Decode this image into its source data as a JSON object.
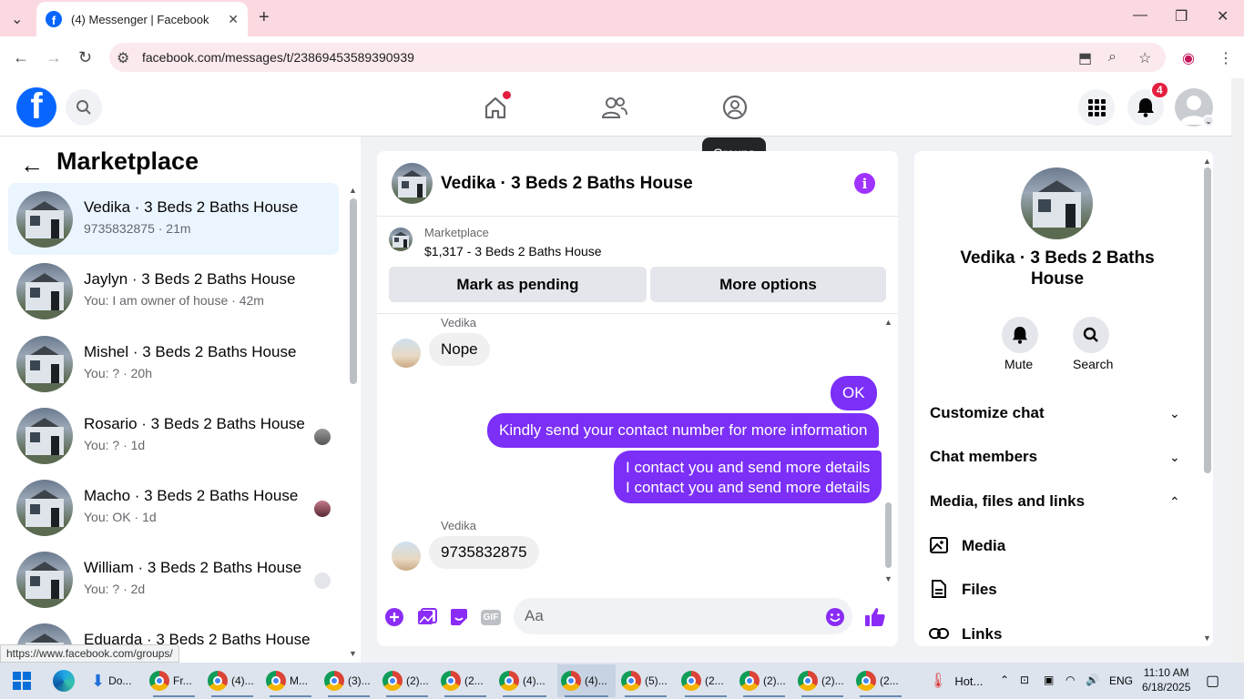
{
  "browser": {
    "tab_title": "(4) Messenger | Facebook",
    "url": "facebook.com/messages/t/23869453589390939",
    "status_url": "https://www.facebook.com/groups/"
  },
  "header": {
    "notifications_count": "4",
    "tooltip": "Groups"
  },
  "sidebar": {
    "title": "Marketplace",
    "conversations": [
      {
        "name": "Vedika · 3 Beds 2 Baths House",
        "preview": "9735832875 · 21m"
      },
      {
        "name": "Jaylyn · 3 Beds 2 Baths House",
        "preview": "You: I am owner of house · 42m"
      },
      {
        "name": "Mishel · 3 Beds 2 Baths House",
        "preview": "You: ? · 20h"
      },
      {
        "name": "Rosario · 3 Beds 2 Baths House",
        "preview": "You: ? · 1d"
      },
      {
        "name": "Macho · 3 Beds 2 Baths House",
        "preview": "You: OK · 1d"
      },
      {
        "name": "William · 3 Beds 2 Baths House",
        "preview": "You: ? · 2d"
      },
      {
        "name": "Eduarda · 3 Beds 2 Baths House",
        "preview": ""
      }
    ]
  },
  "chat": {
    "title": "Vedika · 3 Beds 2 Baths House",
    "marketplace_label": "Marketplace",
    "listing": "$1,317 - 3 Beds 2 Baths House",
    "mark_pending": "Mark as pending",
    "more_options": "More options",
    "messages": [
      {
        "sender": "Vedika",
        "text": "Nope"
      },
      {
        "text": "OK"
      },
      {
        "text": "Kindly send your contact number for more information"
      },
      {
        "text": "I contact you and send more details"
      },
      {
        "text": "I contact you and send more details"
      },
      {
        "sender": "Vedika",
        "text": "9735832875"
      }
    ],
    "composer_placeholder": "Aa",
    "gif_label": "GIF"
  },
  "details": {
    "name": "Vedika · 3 Beds 2 Baths House",
    "mute": "Mute",
    "search": "Search",
    "customize": "Customize chat",
    "members": "Chat members",
    "media_files_links": "Media, files and links",
    "media": "Media",
    "files": "Files",
    "links": "Links"
  },
  "taskbar": {
    "items": [
      "Do...",
      "Fr...",
      "(4)...",
      "M...",
      "(3)...",
      "(2)...",
      "(2...",
      "(4)...",
      "(4)...",
      "(5)...",
      "(2...",
      "(2)...",
      "(2)...",
      "(2..."
    ],
    "weather": "Hot...",
    "lang": "ENG",
    "time": "11:10 AM",
    "date": "6/18/2025"
  },
  "colors": {
    "accent": "#7b2ff7",
    "facebook_blue": "#0866ff",
    "active_row": "#ebf5ff"
  }
}
